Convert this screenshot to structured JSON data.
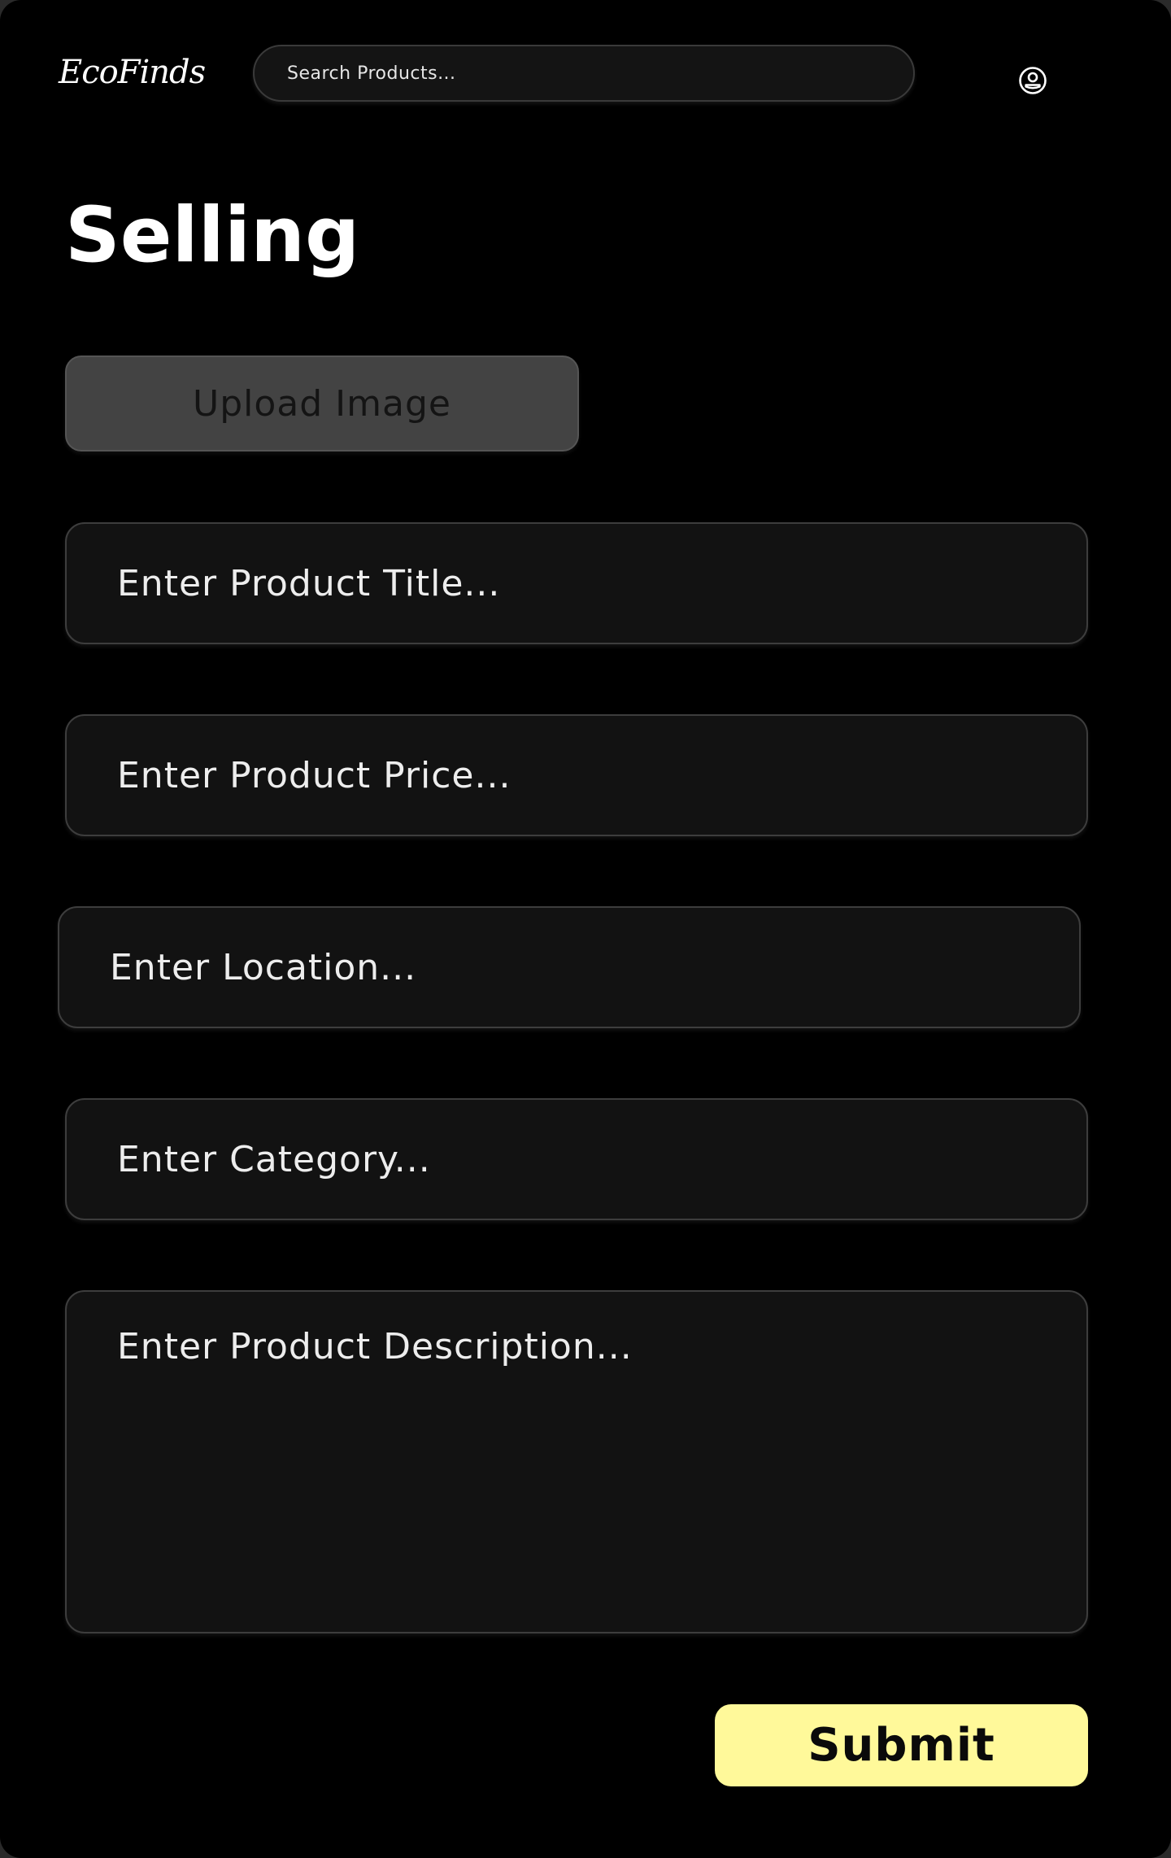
{
  "header": {
    "logo_text": "EcoFinds",
    "search_placeholder": "Search Products...",
    "profile_icon": "user-circle-icon"
  },
  "page": {
    "title": "Selling"
  },
  "form": {
    "upload_label": "Upload Image",
    "fields": {
      "title_placeholder": "Enter Product Title...",
      "price_placeholder": "Enter Product Price...",
      "location_placeholder": "Enter Location...",
      "category_placeholder": "Enter Category...",
      "description_placeholder": "Enter Product Description..."
    },
    "submit_label": "Submit"
  },
  "colors": {
    "background": "#000000",
    "field_background": "#121212",
    "upload_button": "#434343",
    "submit_button": "#fff99a",
    "text": "#ffffff"
  }
}
